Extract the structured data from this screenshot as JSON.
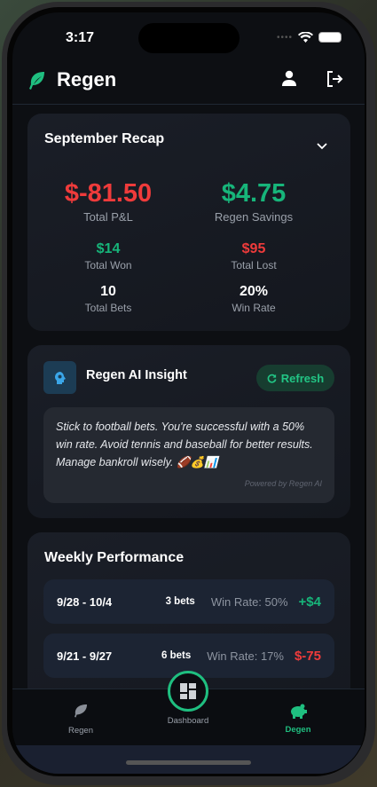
{
  "status_bar": {
    "time": "3:17"
  },
  "header": {
    "brand": "Regen",
    "profile_icon": "user-icon",
    "logout_icon": "logout-icon"
  },
  "recap": {
    "title": "September Recap",
    "total_pl": {
      "value": "$-81.50",
      "label": "Total P&L"
    },
    "savings": {
      "value": "$4.75",
      "label": "Regen Savings"
    },
    "won": {
      "value": "$14",
      "label": "Total Won"
    },
    "lost": {
      "value": "$95",
      "label": "Total Lost"
    },
    "bets": {
      "value": "10",
      "label": "Total Bets"
    },
    "win_rate": {
      "value": "20%",
      "label": "Win Rate"
    }
  },
  "insight": {
    "title": "Regen AI Insight",
    "refresh_label": "Refresh",
    "text": "Stick to football bets. You're successful with a 50% win rate. Avoid tennis and baseball for better results. Manage bankroll wisely. 🏈💰📊",
    "powered": "Powered by Regen AI"
  },
  "weekly": {
    "title": "Weekly Performance",
    "rows": [
      {
        "dates": "9/28 - 10/4",
        "bets": "3 bets",
        "win_rate": "Win Rate: 50%",
        "amount": "+$4"
      },
      {
        "dates": "9/21 - 9/27",
        "bets": "6 bets",
        "win_rate": "Win Rate: 17%",
        "amount": "$-75"
      }
    ]
  },
  "nav": {
    "items": [
      {
        "label": "Regen"
      },
      {
        "label": "Dashboard"
      },
      {
        "label": "Degen",
        "active": true
      }
    ]
  },
  "colors": {
    "positive": "#17b57a",
    "negative": "#ef3b3b",
    "accent": "#1fbf80"
  }
}
